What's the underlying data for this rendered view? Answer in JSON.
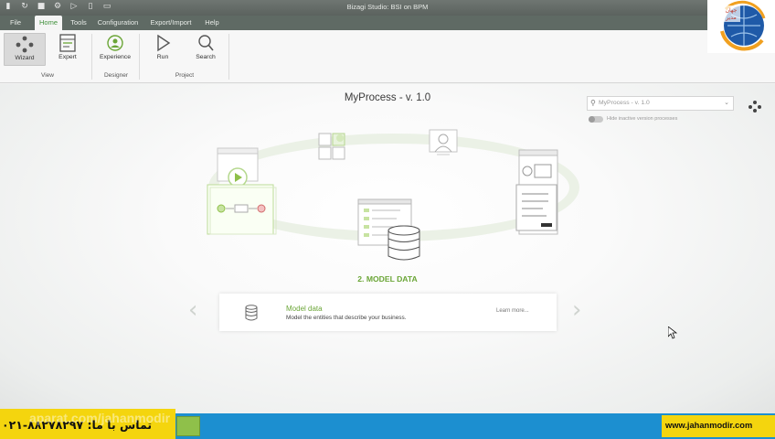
{
  "window": {
    "title": "Bizagi Studio: BSI  on BPM"
  },
  "tabs": [
    {
      "label": "File"
    },
    {
      "label": "Home"
    },
    {
      "label": "Tools"
    },
    {
      "label": "Configuration"
    },
    {
      "label": "Export/Import"
    },
    {
      "label": "Help"
    }
  ],
  "ribbon": {
    "buttons": {
      "wizard": "Wizard",
      "expert": "Expert",
      "experience": "Experience",
      "run": "Run",
      "search": "Search"
    },
    "groups": {
      "view": "View",
      "designer": "Designer",
      "project": "Project"
    }
  },
  "main": {
    "process_title": "MyProcess - v. 1.0",
    "search_placeholder": "MyProcess - v. 1.0",
    "toggle_label": "Hide inactive version processes",
    "step_label": "2. MODEL DATA",
    "card": {
      "title": "Model data",
      "description": "Model the entities that describe your business.",
      "learn_more": "Learn more..."
    }
  },
  "overlay": {
    "phone": "تماس با ما: ۸۸۲۷۸۲۹۷-۰۲۱",
    "watermark": "aparat.com/jahanmodir",
    "website": "www.jahanmodir.com",
    "logo_text": "جهان مدیر"
  },
  "colors": {
    "accent_green": "#6aa536",
    "tab_bar": "#5f6a64",
    "taskbar_blue": "#1c8fd0",
    "banner_yellow": "#f4d50e"
  }
}
